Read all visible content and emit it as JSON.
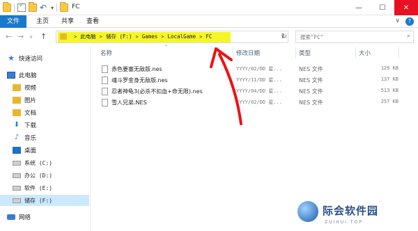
{
  "window": {
    "title": "FC",
    "controls": {
      "minimize": "—",
      "maximize": "☐",
      "close": "✕"
    }
  },
  "ribbon": {
    "tabs": [
      "文件",
      "主页",
      "共享",
      "查看"
    ],
    "expand": "∨",
    "help": "?"
  },
  "address": {
    "crumbs": [
      "此电脑",
      "储存 (F:)",
      "Games",
      "LocalGame",
      "FC"
    ],
    "separator": ">"
  },
  "search": {
    "placeholder": "搜索\"FC\""
  },
  "sidebar": {
    "items": [
      {
        "label": "快速访问",
        "icon": "star-icon"
      },
      {
        "label": "此电脑",
        "icon": "computer-icon"
      },
      {
        "label": "视频",
        "icon": "video-folder-icon"
      },
      {
        "label": "图片",
        "icon": "pictures-folder-icon"
      },
      {
        "label": "文档",
        "icon": "documents-folder-icon"
      },
      {
        "label": "下载",
        "icon": "download-icon"
      },
      {
        "label": "音乐",
        "icon": "music-icon"
      },
      {
        "label": "桌面",
        "icon": "desktop-icon"
      },
      {
        "label": "系统 (C:)",
        "icon": "drive-icon"
      },
      {
        "label": "办公 (D:)",
        "icon": "drive-icon"
      },
      {
        "label": "软件 (E:)",
        "icon": "drive-icon"
      },
      {
        "label": "储存 (F:)",
        "icon": "drive-icon"
      },
      {
        "label": "网络",
        "icon": "network-icon"
      }
    ]
  },
  "columns": {
    "name": "名称",
    "modified": "修改日期",
    "type": "类型",
    "size": "大小"
  },
  "files": [
    {
      "name": "赤色要塞无敌版.nes",
      "date": "YYYY/02/DD 星...",
      "type": "NES 文件",
      "size": "129 KB"
    },
    {
      "name": "魂斗罗金身无敌版.nes",
      "date": "YYYY/11/DD 星...",
      "type": "NES 文件",
      "size": "137 KB"
    },
    {
      "name": "忍者神龟3(必杀不扣血+命无限).nes",
      "date": "YYYY/04/DD 星...",
      "type": "NES 文件",
      "size": "513 KB"
    },
    {
      "name": "雪人兄弟.NES",
      "date": "YYYY/02/DD 星...",
      "type": "NES 文件",
      "size": "257 KB"
    }
  ],
  "watermark": {
    "title": "际会软件园",
    "subtitle": "ZUIHUI.TOP"
  },
  "colors": {
    "accent": "#1979ca",
    "highlight": "#f5f52a",
    "annotation": "#ee1111",
    "selected": "#cce8ff"
  }
}
